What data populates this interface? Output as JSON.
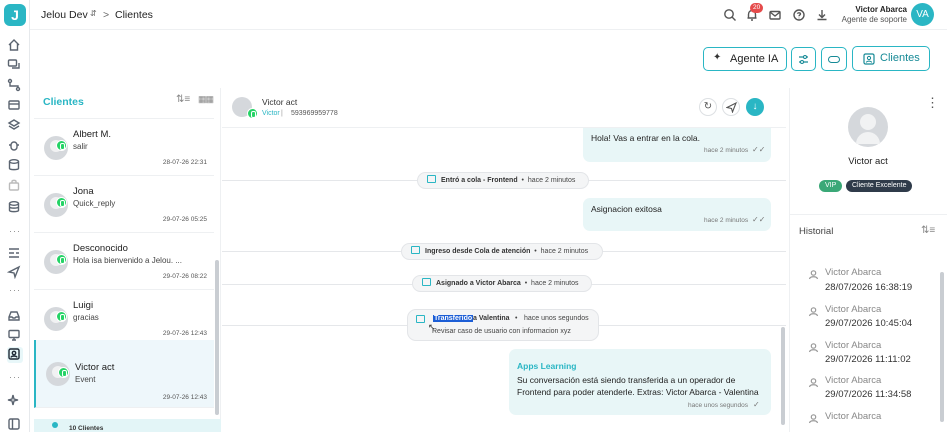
{
  "app": {
    "logo_letter": "J",
    "workspace": "Jelou Dev",
    "separator": ">",
    "page": "Clientes",
    "notifications_count": "20",
    "user_name": "Victor Abarca",
    "user_role": "Agente de soporte",
    "user_initials": "VA"
  },
  "toolbar": {
    "agent_ia_label": "Agente IA",
    "clients_label": "Clientes"
  },
  "clients_panel": {
    "title": "Clientes",
    "footer_count": "10 Clientes",
    "items": [
      {
        "name": "Albert M.",
        "message": "salir",
        "time": "28-07-26 22:31"
      },
      {
        "name": "Jona",
        "message": "Quick_reply",
        "time": "29-07-26 05:25"
      },
      {
        "name": "Desconocido",
        "message": "Hola isa bienvenido a Jelou. ...",
        "time": "29-07-26 08:22"
      },
      {
        "name": "Luigi",
        "message": "gracias",
        "time": "29-07-26 12:43"
      },
      {
        "name": "Victor act",
        "message": "Event",
        "time": "29-07-26 12:43"
      }
    ]
  },
  "chat": {
    "contact_name": "Victor act",
    "contact_sub_name": "Victor",
    "contact_phone": "593969959778",
    "messages": [
      {
        "text": "Hola! Vas a entrar en la cola.",
        "meta": "hace 2 minutos"
      },
      {
        "text": "Asignacion exitosa",
        "meta": "hace 2 minutos"
      }
    ],
    "events": [
      {
        "label": "Entró a cola - Frontend",
        "time": "hace 2 minutos"
      },
      {
        "label": "Ingreso desde Cola de atención",
        "time": "hace 2 minutos"
      },
      {
        "label": "Asignado a Victor Abarca",
        "time": "hace 2 minutos"
      }
    ],
    "transfer": {
      "highlight": "Transferido",
      "rest": " a Valentina",
      "time": "hace unos segundos",
      "note": "Revisar caso de usuario con informacion xyz"
    },
    "bot_message": {
      "sender": "Apps Learning",
      "text": "Su conversación está siendo transferida a un operador de Frontend para poder atenderle. Extras: Victor Abarca - Valentina",
      "meta": "hace unos segundos"
    }
  },
  "profile": {
    "name": "Victor act",
    "tags": [
      "VIP",
      "Cliente Excelente"
    ],
    "history_title": "Historial",
    "history": [
      {
        "name": "Victor Abarca",
        "date": "28/07/2026 16:38:19"
      },
      {
        "name": "Victor Abarca",
        "date": "29/07/2026 10:45:04"
      },
      {
        "name": "Victor Abarca",
        "date": "29/07/2026 11:11:02"
      },
      {
        "name": "Victor Abarca",
        "date": "29/07/2026 11:34:58"
      },
      {
        "name": "Victor Abarca",
        "date": ""
      }
    ]
  },
  "colors": {
    "accent": "#2ab6c4",
    "whatsapp": "#25d366",
    "badge": "#e54b4b",
    "bubble": "#e8f6f7"
  }
}
